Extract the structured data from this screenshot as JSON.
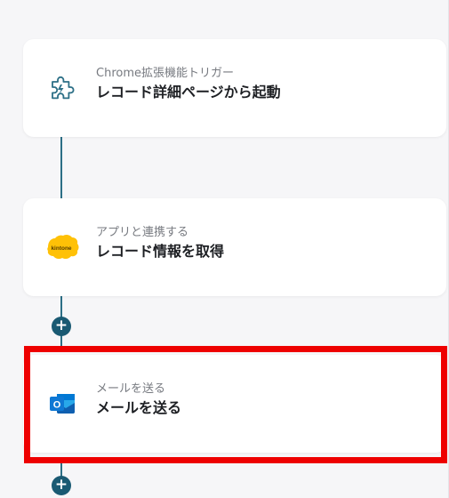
{
  "steps": [
    {
      "subtitle": "Chrome拡張機能トリガー",
      "title": "レコード詳細ページから起動",
      "icon": "puzzle-icon"
    },
    {
      "subtitle": "アプリと連携する",
      "title": "レコード情報を取得",
      "icon": "kintone-icon",
      "icon_text": "kintone"
    },
    {
      "subtitle": "メールを送る",
      "title": "メールを送る",
      "icon": "outlook-icon",
      "icon_text": "O"
    }
  ],
  "add_step_label": "+",
  "colors": {
    "connector": "#2c6f86",
    "add_button": "#1a5a73",
    "highlight": "#ee0000",
    "kintone": "#ffc107",
    "outlook": "#0f78d4"
  }
}
